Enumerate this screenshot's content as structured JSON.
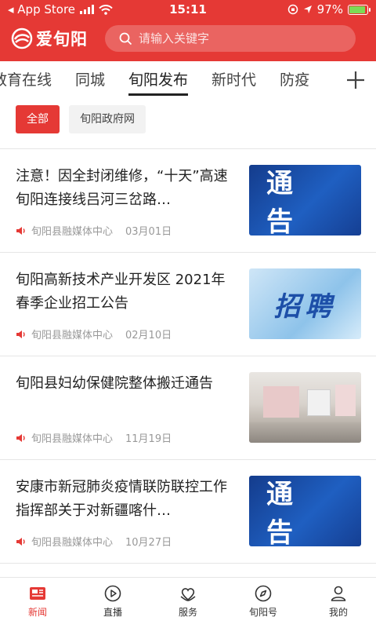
{
  "status_bar": {
    "carrier": "◂ App Store",
    "time": "15:11",
    "battery": "97%"
  },
  "header": {
    "logo_text": "爱旬阳",
    "search_placeholder": "请输入关键字"
  },
  "tabs": [
    {
      "label": "教育在线",
      "active": false
    },
    {
      "label": "同城",
      "active": false
    },
    {
      "label": "旬阳发布",
      "active": true
    },
    {
      "label": "新时代",
      "active": false
    },
    {
      "label": "防疫",
      "active": false
    }
  ],
  "chips": [
    {
      "label": "全部",
      "active": true
    },
    {
      "label": "旬阳政府网",
      "active": false
    }
  ],
  "news": [
    {
      "title": "注意！因全封闭维修，“十天”高速旬阳连接线吕河三岔路…",
      "source": "旬阳县融媒体中心",
      "date": "03月01日",
      "thumb_text": "通 告",
      "thumb_style": "notice"
    },
    {
      "title": "旬阳高新技术产业开发区 2021年春季企业招工公告",
      "source": "旬阳县融媒体中心",
      "date": "02月10日",
      "thumb_text": "招聘",
      "thumb_style": "recruit"
    },
    {
      "title": "旬阳县妇幼保健院整体搬迁通告",
      "source": "旬阳县融媒体中心",
      "date": "11月19日",
      "thumb_text": "",
      "thumb_style": "room"
    },
    {
      "title": "安康市新冠肺炎疫情联防联控工作指挥部关于对新疆喀什…",
      "source": "旬阳县融媒体中心",
      "date": "10月27日",
      "thumb_text": "通 告",
      "thumb_style": "notice"
    }
  ],
  "bottom_nav": [
    {
      "label": "新闻",
      "icon": "news-icon",
      "active": true
    },
    {
      "label": "直播",
      "icon": "live-play-icon",
      "active": false
    },
    {
      "label": "服务",
      "icon": "service-heart-icon",
      "active": false
    },
    {
      "label": "旬阳号",
      "icon": "compass-icon",
      "active": false
    },
    {
      "label": "我的",
      "icon": "profile-icon",
      "active": false
    }
  ],
  "colors": {
    "brand_red": "#e53935",
    "text": "#222222",
    "muted": "#999999"
  }
}
